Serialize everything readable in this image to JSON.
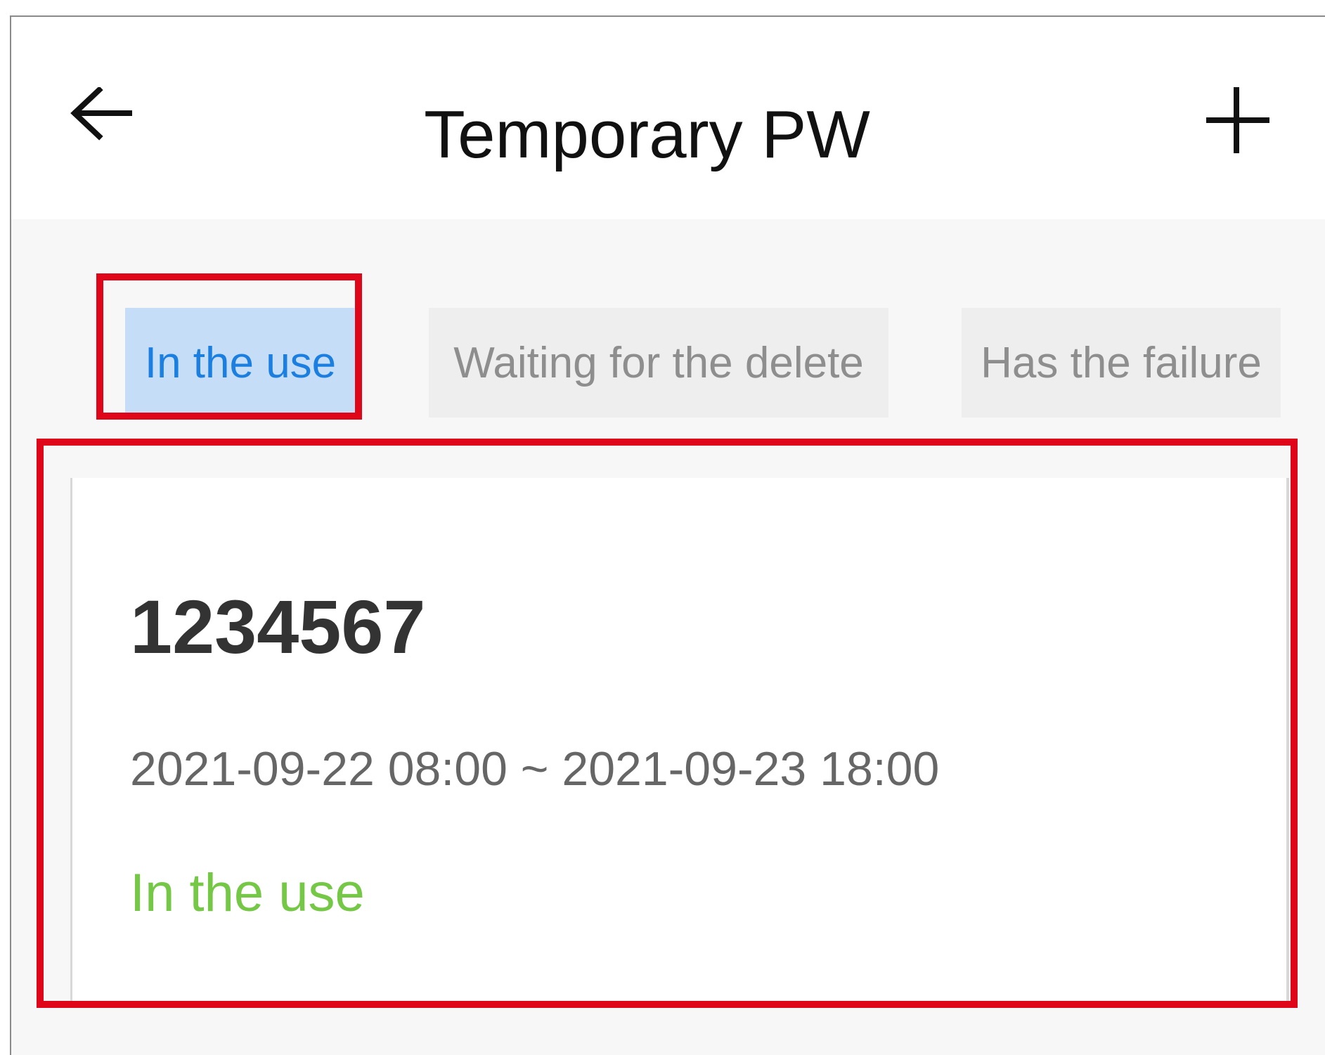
{
  "header": {
    "title": "Temporary PW",
    "back_icon": "arrow-left-icon",
    "add_icon": "plus-icon"
  },
  "tabs": [
    {
      "label": "In the use",
      "active": true
    },
    {
      "label": "Waiting for the delete",
      "active": false
    },
    {
      "label": "Has the failure",
      "active": false
    }
  ],
  "password_card": {
    "code": "1234567",
    "validity": "2021-09-22 08:00 ~ 2021-09-23 18:00",
    "status": "In the use"
  },
  "colors": {
    "active_tab_bg": "#c6ddf7",
    "active_tab_text": "#1a7fe0",
    "inactive_tab_bg": "#eeeeee",
    "inactive_tab_text": "#8e8e8e",
    "status_green": "#74c845",
    "highlight_red": "#e0061a"
  }
}
